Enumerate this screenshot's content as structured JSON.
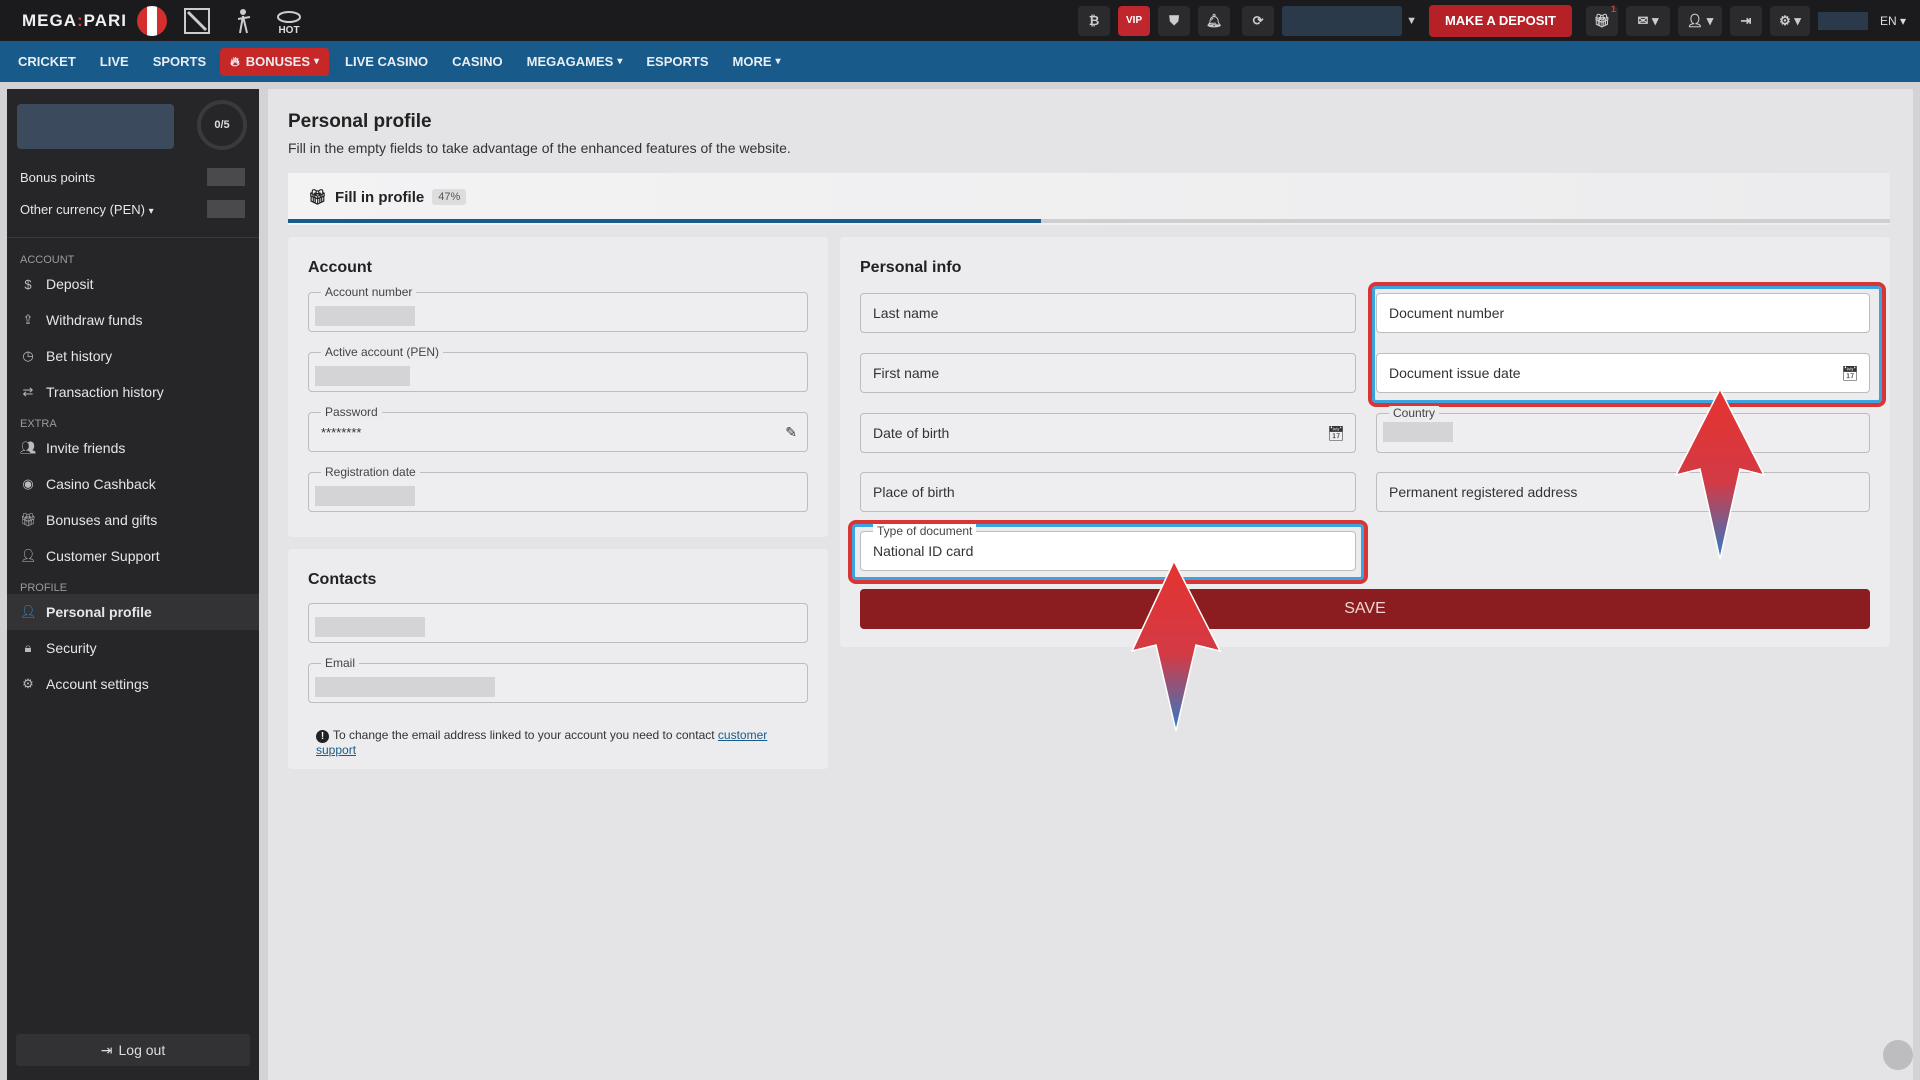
{
  "brand": {
    "logo_left": "MEGA",
    "logo_right": "PARI",
    "hot_badge": "HOT"
  },
  "topbar": {
    "btc_icon": "bitcoin-icon",
    "vip_label": "VIP",
    "deposit_label": "MAKE A DEPOSIT",
    "gift_count": "1",
    "lang": "EN"
  },
  "nav": {
    "items": [
      "CRICKET",
      "LIVE",
      "SPORTS",
      "BONUSES",
      "LIVE CASINO",
      "CASINO",
      "MEGAGAMES",
      "ESPORTS",
      "MORE"
    ]
  },
  "sidebar": {
    "progress": "0/5",
    "bonus_points": "Bonus points",
    "other_currency": "Other currency (PEN)",
    "sections": {
      "account": "ACCOUNT",
      "extra": "EXTRA",
      "profile": "PROFILE"
    },
    "account_items": [
      "Deposit",
      "Withdraw funds",
      "Bet history",
      "Transaction history"
    ],
    "extra_items": [
      "Invite friends",
      "Casino Cashback",
      "Bonuses and gifts",
      "Customer Support"
    ],
    "profile_items": [
      "Personal profile",
      "Security",
      "Account settings"
    ],
    "logout": "Log out"
  },
  "main": {
    "title": "Personal profile",
    "subtitle": "Fill in the empty fields to take advantage of the enhanced features of the website.",
    "fill_title": "Fill in profile",
    "fill_percent": "47%",
    "progress_value": 0.47
  },
  "account": {
    "title": "Account",
    "account_number_label": "Account number",
    "active_account_label": "Active account (PEN)",
    "password_label": "Password",
    "password_value": "********",
    "registration_date_label": "Registration date"
  },
  "contacts": {
    "title": "Contacts",
    "email_label": "Email",
    "note_text": "To change the email address linked to your account you need to contact",
    "note_link": "customer support"
  },
  "personal": {
    "title": "Personal info",
    "last_name": "Last name",
    "first_name": "First name",
    "date_of_birth": "Date of birth",
    "place_of_birth": "Place of birth",
    "document_number": "Document number",
    "document_issue_date": "Document issue date",
    "country_label": "Country",
    "permanent_address": "Permanent registered address",
    "type_of_document_label": "Type of document",
    "type_of_document_value": "National ID card",
    "save_label": "SAVE"
  }
}
